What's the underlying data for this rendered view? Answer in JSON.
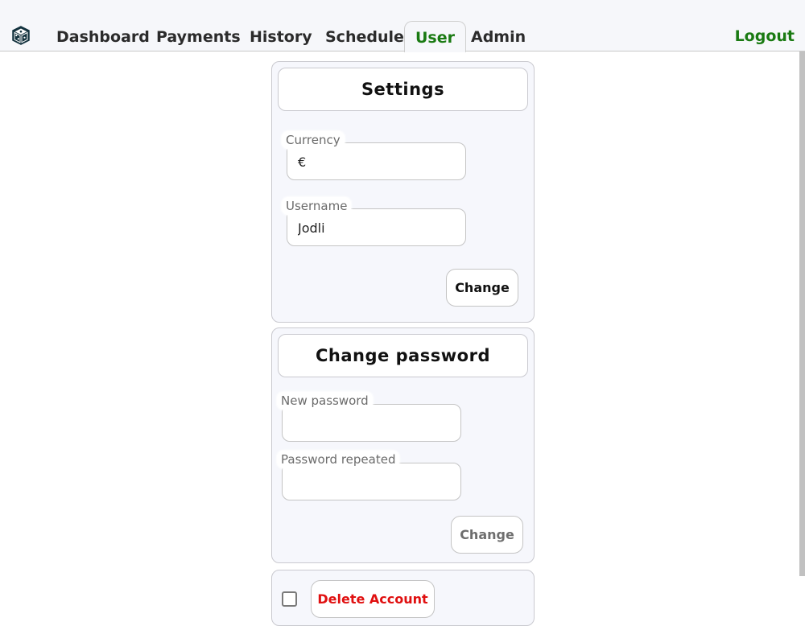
{
  "nav": {
    "logo_icon": "dice-logo-icon",
    "items": [
      {
        "label": "Dashboard"
      },
      {
        "label": "Payments"
      },
      {
        "label": "History"
      },
      {
        "label": "Schedule"
      },
      {
        "label": "User",
        "active": true
      },
      {
        "label": "Admin"
      }
    ],
    "logout": "Logout",
    "accent_color": "#1a7a12"
  },
  "settings": {
    "title": "Settings",
    "currency_label": "Currency",
    "currency_value": "€",
    "username_label": "Username",
    "username_value": "Jodli",
    "submit_label": "Change"
  },
  "password": {
    "title": "Change password",
    "new_label": "New password",
    "new_value": "",
    "repeat_label": "Password repeated",
    "repeat_value": "",
    "submit_label": "Change"
  },
  "danger": {
    "delete_label": "Delete Account",
    "color": "#e01010"
  }
}
